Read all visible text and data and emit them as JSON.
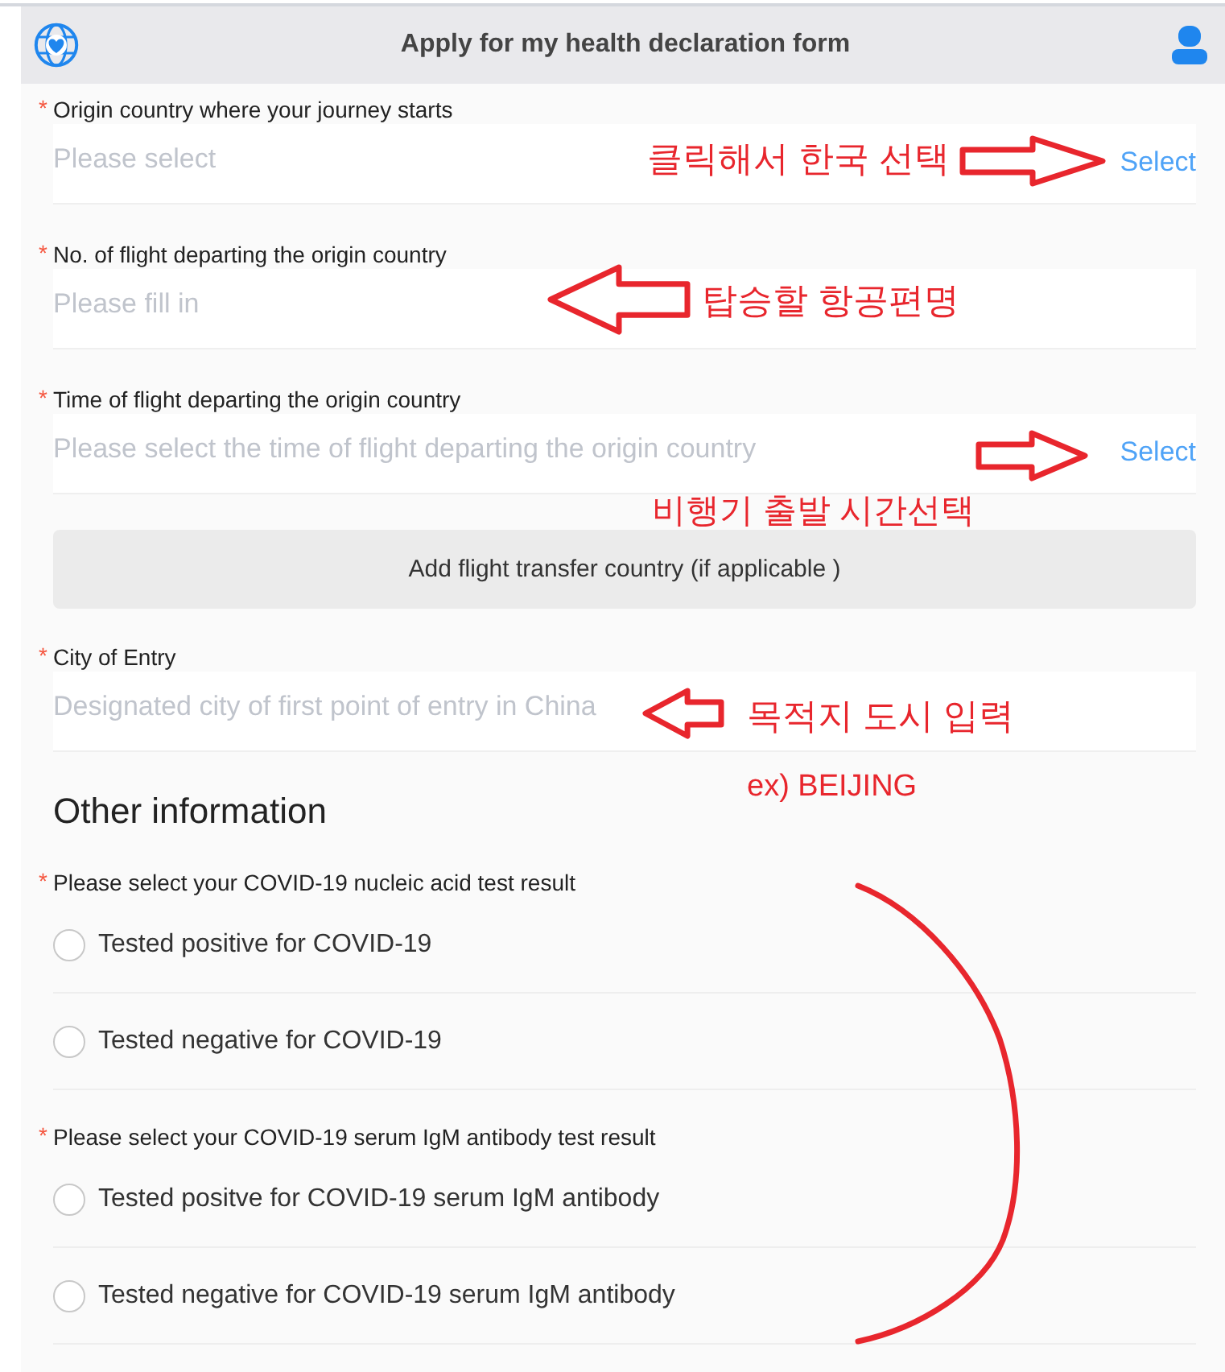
{
  "header": {
    "title": "Apply for my health declaration form"
  },
  "form": {
    "items": [
      {
        "kind": "select-field",
        "required_mark": "*",
        "label": "Origin country where your journey starts",
        "placeholder": "Please select",
        "action": "Select"
      },
      {
        "kind": "text-field",
        "required_mark": "*",
        "label": "No. of flight departing the origin country",
        "placeholder": "Please fill in"
      },
      {
        "kind": "select-field",
        "required_mark": "*",
        "label": "Time of flight departing the origin country",
        "placeholder": "Please select the time of flight departing the origin country",
        "action": "Select"
      },
      {
        "kind": "button",
        "label": "Add flight transfer country (if applicable )"
      },
      {
        "kind": "text-field",
        "required_mark": "*",
        "label": "City of Entry",
        "placeholder": "Designated city of first point of entry in China"
      },
      {
        "kind": "heading",
        "label": "Other information"
      },
      {
        "kind": "radio-group",
        "required_mark": "*",
        "label": "Please select your COVID-19 nucleic acid test result",
        "options": [
          {
            "label": "Tested positive for COVID-19",
            "selected": false
          },
          {
            "label": "Tested negative for COVID-19",
            "selected": false
          }
        ]
      },
      {
        "kind": "radio-group",
        "required_mark": "*",
        "label": "Please select your COVID-19 serum IgM antibody test result",
        "options": [
          {
            "label": "Tested positve for COVID-19 serum IgM antibody",
            "selected": false
          },
          {
            "label": "Tested negative for COVID-19 serum IgM antibody",
            "selected": false
          }
        ]
      }
    ]
  },
  "annotations": [
    {
      "kind": "note",
      "text": "클릭해서 한국 선택"
    },
    {
      "kind": "arrow-right"
    },
    {
      "kind": "arrow-left"
    },
    {
      "kind": "note",
      "text": "탑승할 항공편명"
    },
    {
      "kind": "arrow-right"
    },
    {
      "kind": "note",
      "text": "비행기 출발 시간선택"
    },
    {
      "kind": "arrow-left"
    },
    {
      "kind": "note",
      "text": "목적지 도시 입력"
    },
    {
      "kind": "note",
      "text": "ex) BEIJING"
    },
    {
      "kind": "curve"
    }
  ]
}
